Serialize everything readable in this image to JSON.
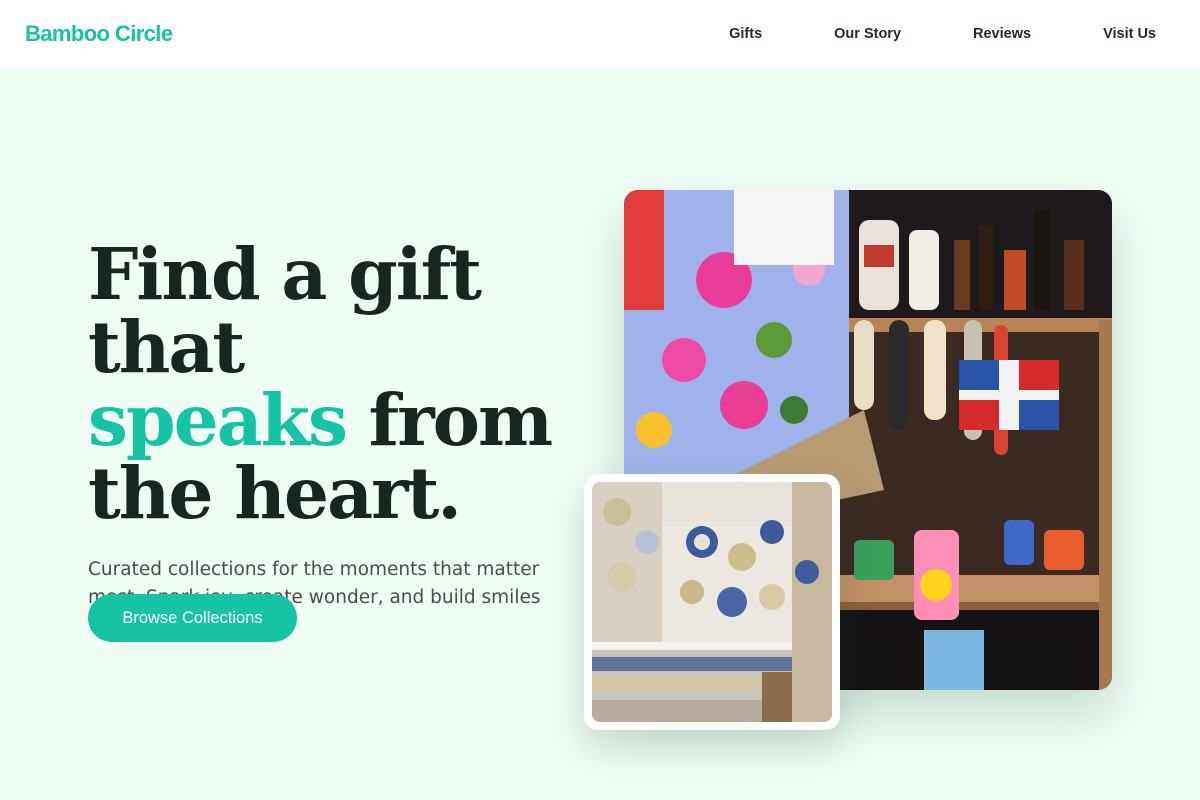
{
  "header": {
    "brand": "Bamboo Circle",
    "nav": [
      "Gifts",
      "Our Story",
      "Reviews",
      "Visit Us"
    ]
  },
  "hero": {
    "headline_line1": "Find a gift that",
    "headline_accent": "speaks",
    "headline_line2_rest": " from",
    "headline_line3": "the heart.",
    "subtext": "Curated collections for the moments that matter most. Spark joy, create wonder, and build smiles with Bamboo Circle.",
    "cta_label": "Browse Collections"
  },
  "images": {
    "main_alt": "market stall with colorful souvenirs, flags and bottles",
    "small_alt": "shop wall with decorative painted ceramic plates"
  },
  "colors": {
    "accent": "#16c4a4",
    "background": "#effdf5",
    "heading": "#17271f",
    "text": "#445049"
  }
}
